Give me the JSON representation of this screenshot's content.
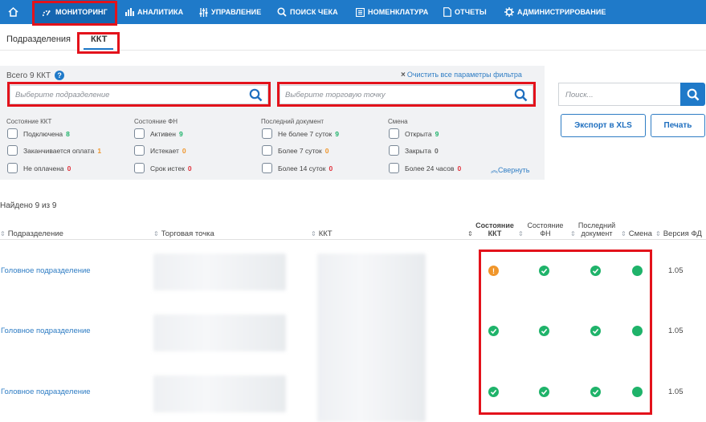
{
  "nav": {
    "items": [
      {
        "label": "МОНИТОРИНГ",
        "icon": "dashboard-icon"
      },
      {
        "label": "АНАЛИТИКА",
        "icon": "bar-chart-icon"
      },
      {
        "label": "УПРАВЛЕНИЕ",
        "icon": "sliders-icon"
      },
      {
        "label": "ПОИСК ЧЕКА",
        "icon": "search-icon"
      },
      {
        "label": "НОМЕНКЛАТУРА",
        "icon": "list-icon"
      },
      {
        "label": "ОТЧЕТЫ",
        "icon": "document-icon"
      },
      {
        "label": "АДМИНИСТРИРОВАНИЕ",
        "icon": "gear-icon"
      }
    ],
    "home_icon": "home-icon"
  },
  "tabs": [
    {
      "label": "Подразделения"
    },
    {
      "label": "ККТ"
    }
  ],
  "filters": {
    "total": "Всего 9 ККТ",
    "clear_all": "Очистить все параметры фильтра",
    "division_placeholder": "Выберите подразделение",
    "outlet_placeholder": "Выберите торговую точку",
    "collapse": "Свернуть",
    "groups": [
      {
        "title": "Состояние ККТ",
        "options": [
          {
            "label": "Подключена",
            "count": "8",
            "color": "green"
          },
          {
            "label": "Заканчивается оплата",
            "count": "1",
            "color": "orange"
          },
          {
            "label": "Не оплачена",
            "count": "0",
            "color": "red"
          }
        ]
      },
      {
        "title": "Состояние ФН",
        "options": [
          {
            "label": "Активен",
            "count": "9",
            "color": "green"
          },
          {
            "label": "Истекает",
            "count": "0",
            "color": "orange"
          },
          {
            "label": "Срок истек",
            "count": "0",
            "color": "red"
          }
        ]
      },
      {
        "title": "Последний документ",
        "options": [
          {
            "label": "Не более 7 суток",
            "count": "9",
            "color": "green"
          },
          {
            "label": "Более 7 суток",
            "count": "0",
            "color": "orange"
          },
          {
            "label": "Более 14 суток",
            "count": "0",
            "color": "red"
          }
        ]
      },
      {
        "title": "Смена",
        "options": [
          {
            "label": "Открыта",
            "count": "9",
            "color": "green"
          },
          {
            "label": "Закрыта",
            "count": "0",
            "color": "gray"
          },
          {
            "label": "Более 24 часов",
            "count": "0",
            "color": "red"
          }
        ]
      }
    ]
  },
  "search": {
    "placeholder": "Поиск..."
  },
  "buttons": {
    "export": "Экспорт в XLS",
    "print": "Печать"
  },
  "table": {
    "found": "Найдено 9 из 9",
    "headers": {
      "division": "Подразделение",
      "outlet": "Торговая точка",
      "kkt": "ККТ",
      "kkt_state_1": "Состояние",
      "kkt_state_2": "ККТ",
      "fn_state_1": "Состояние",
      "fn_state_2": "ФН",
      "last_doc_1": "Последний",
      "last_doc_2": "документ",
      "shift": "Смена",
      "fd_version": "Версия ФД"
    },
    "rows": [
      {
        "division": "Головное подразделение",
        "kkt_state": "warning",
        "fn_state": "ok",
        "last_doc": "ok",
        "shift": "open",
        "fd_version": "1.05"
      },
      {
        "division": "Головное подразделение",
        "kkt_state": "ok",
        "fn_state": "ok",
        "last_doc": "ok",
        "shift": "open",
        "fd_version": "1.05"
      },
      {
        "division": "Головное подразделение",
        "kkt_state": "ok",
        "fn_state": "ok",
        "last_doc": "ok",
        "shift": "open",
        "fd_version": "1.05"
      }
    ]
  },
  "colors": {
    "accent": "#1f7ac9",
    "highlight": "#e3121b",
    "ok": "#1fb36a",
    "warning": "#f0962b",
    "error": "#e0313b"
  }
}
